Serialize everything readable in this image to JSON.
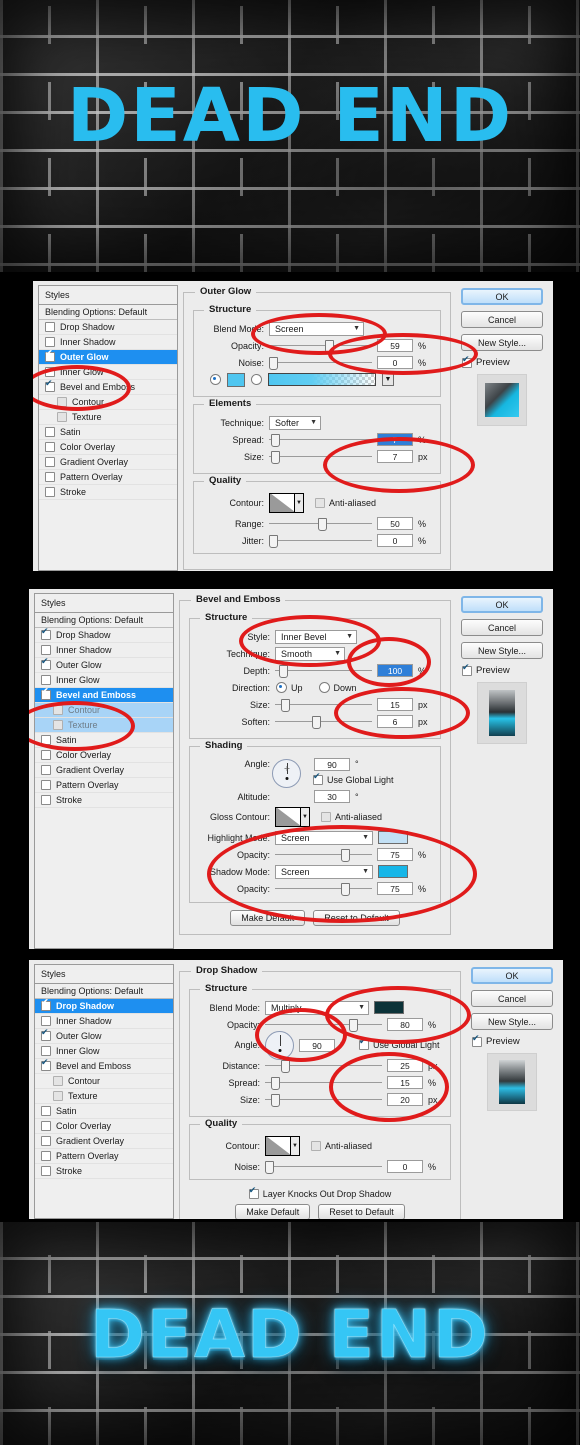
{
  "artwork": {
    "headline_text": "DEAD END",
    "flat_color": "#29bdef",
    "styled_color": "#35c6f5",
    "background": "dark-brick-wall"
  },
  "styles_list": {
    "header": "Styles",
    "blending_options": "Blending Options: Default",
    "items": [
      "Drop Shadow",
      "Inner Shadow",
      "Outer Glow",
      "Inner Glow",
      "Bevel and Emboss",
      "Contour",
      "Texture",
      "Satin",
      "Color Overlay",
      "Gradient Overlay",
      "Pattern Overlay",
      "Stroke"
    ]
  },
  "buttons": {
    "ok": "OK",
    "cancel": "Cancel",
    "new_style": "New Style...",
    "preview": "Preview",
    "make_default": "Make Default",
    "reset_to_default": "Reset to Default"
  },
  "dialogs": [
    {
      "id": "outer-glow",
      "section_title": "Outer Glow",
      "groups": [
        {
          "title": "Structure",
          "fields": [
            {
              "label": "Blend Mode:",
              "type": "select",
              "value": "Screen"
            },
            {
              "label": "Opacity:",
              "type": "slider-num",
              "value": "59",
              "unit": "%"
            },
            {
              "label": "Noise:",
              "type": "slider-num",
              "value": "0",
              "unit": "%"
            },
            {
              "label": "",
              "type": "color-gradient",
              "value": "#4fc6f0"
            }
          ]
        },
        {
          "title": "Elements",
          "fields": [
            {
              "label": "Technique:",
              "type": "select",
              "value": "Softer"
            },
            {
              "label": "Spread:",
              "type": "slider-num",
              "value": "7",
              "unit": "%",
              "highlight": true
            },
            {
              "label": "Size:",
              "type": "slider-num",
              "value": "7",
              "unit": "px"
            }
          ]
        },
        {
          "title": "Quality",
          "fields": [
            {
              "label": "Contour:",
              "type": "contour",
              "value": "Anti-aliased"
            },
            {
              "label": "Range:",
              "type": "slider-num",
              "value": "50",
              "unit": "%"
            },
            {
              "label": "Jitter:",
              "type": "slider-num",
              "value": "0",
              "unit": "%"
            }
          ]
        }
      ],
      "selected_style": "Outer Glow",
      "checked_styles": [
        "Outer Glow",
        "Bevel and Emboss"
      ]
    },
    {
      "id": "bevel-emboss",
      "section_title": "Bevel and Emboss",
      "groups": [
        {
          "title": "Structure",
          "fields": [
            {
              "label": "Style:",
              "type": "select",
              "value": "Inner Bevel"
            },
            {
              "label": "Technique:",
              "type": "select",
              "value": "Smooth"
            },
            {
              "label": "Depth:",
              "type": "slider-num",
              "value": "100",
              "unit": "%",
              "highlight": true
            },
            {
              "label": "Direction:",
              "type": "radio",
              "options": [
                "Up",
                "Down"
              ],
              "value": "Up"
            },
            {
              "label": "Size:",
              "type": "slider-num",
              "value": "15",
              "unit": "px"
            },
            {
              "label": "Soften:",
              "type": "slider-num",
              "value": "6",
              "unit": "px"
            }
          ]
        },
        {
          "title": "Shading",
          "fields": [
            {
              "label": "Angle:",
              "type": "angle",
              "value": "90",
              "unit": "°",
              "checkbox": "Use Global Light"
            },
            {
              "label": "Altitude:",
              "type": "num",
              "value": "30",
              "unit": "°"
            },
            {
              "label": "Gloss Contour:",
              "type": "contour",
              "value": "Anti-aliased"
            },
            {
              "label": "Highlight Mode:",
              "type": "select-color",
              "value": "Screen",
              "color": "#c2e0f5"
            },
            {
              "label": "Opacity:",
              "type": "slider-num",
              "value": "75",
              "unit": "%"
            },
            {
              "label": "Shadow Mode:",
              "type": "select-color",
              "value": "Screen",
              "color": "#16b6e8"
            },
            {
              "label": "Opacity:",
              "type": "slider-num",
              "value": "75",
              "unit": "%"
            }
          ]
        }
      ],
      "selected_style": "Bevel and Emboss",
      "checked_styles": [
        "Drop Shadow",
        "Outer Glow",
        "Bevel and Emboss"
      ]
    },
    {
      "id": "drop-shadow",
      "section_title": "Drop Shadow",
      "groups": [
        {
          "title": "Structure",
          "fields": [
            {
              "label": "Blend Mode:",
              "type": "select-color",
              "value": "Multiply",
              "color": "#0b3238"
            },
            {
              "label": "Opacity:",
              "type": "slider-num",
              "value": "80",
              "unit": "%"
            },
            {
              "label": "Angle:",
              "type": "angle",
              "value": "90",
              "unit": "°",
              "checkbox": "Use Global Light"
            },
            {
              "label": "Distance:",
              "type": "slider-num",
              "value": "25",
              "unit": "px"
            },
            {
              "label": "Spread:",
              "type": "slider-num",
              "value": "15",
              "unit": "%"
            },
            {
              "label": "Size:",
              "type": "slider-num",
              "value": "20",
              "unit": "px"
            }
          ]
        },
        {
          "title": "Quality",
          "fields": [
            {
              "label": "Contour:",
              "type": "contour",
              "value": "Anti-aliased"
            },
            {
              "label": "Noise:",
              "type": "slider-num",
              "value": "0",
              "unit": "%"
            },
            {
              "label": "",
              "type": "checkbox",
              "value": "Layer Knocks Out Drop Shadow",
              "checked": true
            }
          ]
        }
      ],
      "selected_style": "Drop Shadow",
      "checked_styles": [
        "Drop Shadow",
        "Outer Glow",
        "Bevel and Emboss"
      ]
    }
  ],
  "annotation_color": "#e01b1b"
}
